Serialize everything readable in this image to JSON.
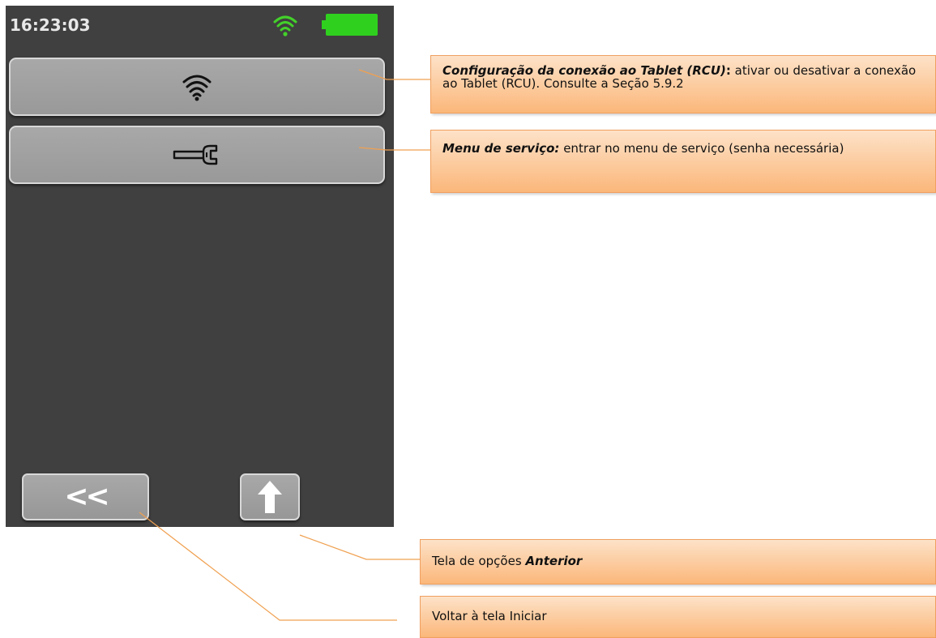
{
  "device": {
    "clock": "16:23:03",
    "icons": {
      "wifi_status": "wifi-icon",
      "battery": "battery-icon"
    },
    "menu": [
      {
        "id": "rcu",
        "icon": "wifi-icon"
      },
      {
        "id": "service",
        "icon": "wrench-icon"
      }
    ],
    "nav": {
      "back_label": "<<",
      "up_icon": "arrow-up-icon"
    },
    "colors": {
      "screen": "#404040",
      "button": "#a0a0a0",
      "battery": "#2fd11e",
      "wifi": "#43d12a"
    }
  },
  "callouts": {
    "rcu": {
      "title": "Configuração da conexão ao Tablet (RCU)",
      "colon": ":",
      "text": " ativar ou desativar a conexão ao Tablet (RCU). Consulte a Seção 5.9.2"
    },
    "service": {
      "title": "Menu de serviço:",
      "text": " entrar no menu de serviço (senha necessária)"
    },
    "previous": {
      "text": "Tela de opções ",
      "title": "Anterior"
    },
    "home": {
      "text": "Voltar à tela Iniciar"
    }
  }
}
